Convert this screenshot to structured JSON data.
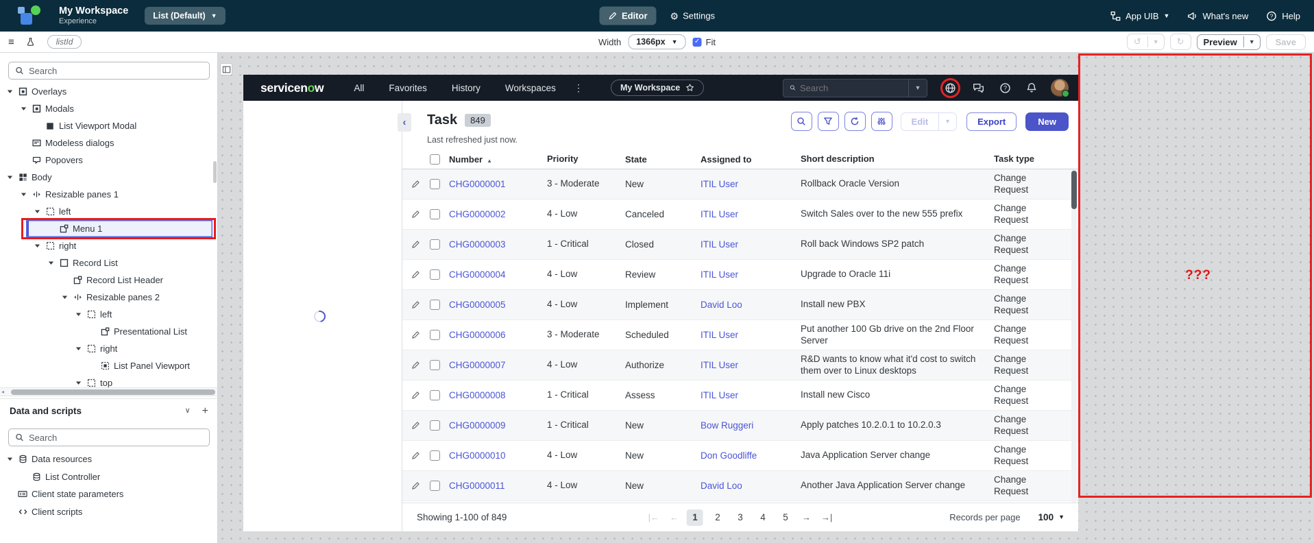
{
  "app_header": {
    "workspace_name": "My Workspace",
    "workspace_subtitle": "Experience",
    "page_selector_label": "List (Default)",
    "editor_tab": "Editor",
    "settings_tab": "Settings",
    "app_menu_label": "App UIB",
    "whats_new_label": "What's new",
    "help_label": "Help"
  },
  "toolbar": {
    "context_pill": "listId",
    "width_label": "Width",
    "width_value": "1366px",
    "fit_label": "Fit",
    "preview_label": "Preview",
    "save_label": "Save"
  },
  "content_tree": {
    "search_placeholder": "Search",
    "items": [
      {
        "label": "Overlays",
        "depth": 0,
        "icon": "overlay",
        "expanded": true
      },
      {
        "label": "Modals",
        "depth": 1,
        "icon": "overlay",
        "expanded": true
      },
      {
        "label": "List Viewport Modal",
        "depth": 2,
        "icon": "modal"
      },
      {
        "label": "Modeless dialogs",
        "depth": 1,
        "icon": "dialog"
      },
      {
        "label": "Popovers",
        "depth": 1,
        "icon": "popover"
      },
      {
        "label": "Body",
        "depth": 0,
        "icon": "body",
        "expanded": true
      },
      {
        "label": "Resizable panes 1",
        "depth": 1,
        "icon": "resizable",
        "expanded": true
      },
      {
        "label": "left",
        "depth": 2,
        "icon": "container",
        "expanded": true
      },
      {
        "label": "Menu 1",
        "depth": 3,
        "icon": "component",
        "selected": true
      },
      {
        "label": "right",
        "depth": 2,
        "icon": "container",
        "expanded": true
      },
      {
        "label": "Record List",
        "depth": 3,
        "icon": "record-list",
        "expanded": true
      },
      {
        "label": "Record List Header",
        "depth": 4,
        "icon": "component"
      },
      {
        "label": "Resizable panes 2",
        "depth": 4,
        "icon": "resizable",
        "expanded": true
      },
      {
        "label": "left",
        "depth": 5,
        "icon": "container",
        "expanded": true
      },
      {
        "label": "Presentational List",
        "depth": 6,
        "icon": "component"
      },
      {
        "label": "right",
        "depth": 5,
        "icon": "container",
        "expanded": true
      },
      {
        "label": "List Panel Viewport",
        "depth": 6,
        "icon": "viewport"
      },
      {
        "label": "top",
        "depth": 5,
        "icon": "container",
        "expanded": true
      }
    ]
  },
  "data_panel": {
    "title": "Data and scripts",
    "search_placeholder": "Search",
    "items": [
      {
        "label": "Data resources",
        "depth": 0,
        "icon": "database",
        "expanded": true
      },
      {
        "label": "List Controller",
        "depth": 1,
        "icon": "database"
      },
      {
        "label": "Client state parameters",
        "depth": 0,
        "icon": "fields"
      },
      {
        "label": "Client scripts",
        "depth": 0,
        "icon": "code"
      }
    ]
  },
  "preview": {
    "nav": {
      "brand_pre": "servicen",
      "brand_accent": "o",
      "brand_post": "w",
      "links": [
        "All",
        "Favorites",
        "History",
        "Workspaces"
      ],
      "workspace_pill": "My Workspace",
      "search_placeholder": "Search"
    },
    "list": {
      "title": "Task",
      "count": "849",
      "refreshed_text": "Last refreshed just now.",
      "edit_label": "Edit",
      "export_label": "Export",
      "new_label": "New",
      "columns": [
        "Number",
        "Priority",
        "State",
        "Assigned to",
        "Short description",
        "Task type"
      ],
      "sorted_column": "Number",
      "rows": [
        {
          "number": "CHG0000001",
          "priority": "3 - Moderate",
          "state": "New",
          "assigned_to": "ITIL User",
          "short_description": "Rollback Oracle Version",
          "task_type": "Change Request"
        },
        {
          "number": "CHG0000002",
          "priority": "4 - Low",
          "state": "Canceled",
          "assigned_to": "ITIL User",
          "short_description": "Switch Sales over to the new 555 prefix",
          "task_type": "Change Request"
        },
        {
          "number": "CHG0000003",
          "priority": "1 - Critical",
          "state": "Closed",
          "assigned_to": "ITIL User",
          "short_description": "Roll back Windows SP2 patch",
          "task_type": "Change Request"
        },
        {
          "number": "CHG0000004",
          "priority": "4 - Low",
          "state": "Review",
          "assigned_to": "ITIL User",
          "short_description": "Upgrade to Oracle 11i",
          "task_type": "Change Request"
        },
        {
          "number": "CHG0000005",
          "priority": "4 - Low",
          "state": "Implement",
          "assigned_to": "David Loo",
          "short_description": "Install new PBX",
          "task_type": "Change Request"
        },
        {
          "number": "CHG0000006",
          "priority": "3 - Moderate",
          "state": "Scheduled",
          "assigned_to": "ITIL User",
          "short_description": "Put another 100 Gb drive on the 2nd Floor Server",
          "task_type": "Change Request"
        },
        {
          "number": "CHG0000007",
          "priority": "4 - Low",
          "state": "Authorize",
          "assigned_to": "ITIL User",
          "short_description": "R&D wants to know what it'd cost to switch them over to Linux desktops",
          "task_type": "Change Request"
        },
        {
          "number": "CHG0000008",
          "priority": "1 - Critical",
          "state": "Assess",
          "assigned_to": "ITIL User",
          "short_description": "Install new Cisco",
          "task_type": "Change Request"
        },
        {
          "number": "CHG0000009",
          "priority": "1 - Critical",
          "state": "New",
          "assigned_to": "Bow Ruggeri",
          "short_description": "Apply patches 10.2.0.1 to 10.2.0.3",
          "task_type": "Change Request"
        },
        {
          "number": "CHG0000010",
          "priority": "4 - Low",
          "state": "New",
          "assigned_to": "Don Goodliffe",
          "short_description": "Java Application Server change",
          "task_type": "Change Request"
        },
        {
          "number": "CHG0000011",
          "priority": "4 - Low",
          "state": "New",
          "assigned_to": "David Loo",
          "short_description": "Another Java Application Server change",
          "task_type": "Change Request"
        }
      ],
      "footer": {
        "showing_text": "Showing 1-100 of 849",
        "pages": [
          "1",
          "2",
          "3",
          "4",
          "5"
        ],
        "current_page": "1",
        "records_per_page_label": "Records per page",
        "records_per_page_value": "100"
      }
    },
    "placeholder_text": "???"
  },
  "colors": {
    "header_bg": "#0b2c3c",
    "nav_bg": "#161c26",
    "accent_indigo": "#4c55c9",
    "annotation_red": "#e62222",
    "brand_green": "#63d84f",
    "selected_row_bg": "#edf1fc"
  }
}
